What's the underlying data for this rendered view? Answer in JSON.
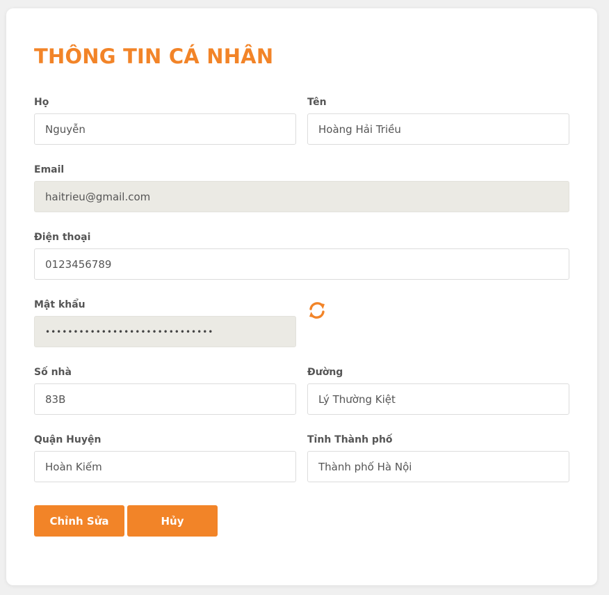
{
  "page": {
    "title": "THÔNG TIN CÁ NHÂN",
    "accent_color": "#f28428"
  },
  "form": {
    "last_name": {
      "label": "Họ",
      "value": "Nguyễn"
    },
    "first_name": {
      "label": "Tên",
      "value": "Hoàng Hải Triều"
    },
    "email": {
      "label": "Email",
      "value": "haitrieu@gmail.com"
    },
    "phone": {
      "label": "Điện thoại",
      "value": "0123456789"
    },
    "password": {
      "label": "Mật khẩu",
      "value": "••••••••••••••••••••••••••••••",
      "refresh_icon": "refresh-icon"
    },
    "house_number": {
      "label": "Số nhà",
      "value": "83B"
    },
    "street": {
      "label": "Đường",
      "value": "Lý Thường Kiệt"
    },
    "district": {
      "label": "Quận Huyện",
      "value": "Hoàn Kiếm"
    },
    "province": {
      "label": "Tỉnh Thành phố",
      "value": "Thành phố Hà Nội"
    }
  },
  "actions": {
    "edit_label": "Chỉnh Sửa",
    "cancel_label": "Hủy"
  }
}
